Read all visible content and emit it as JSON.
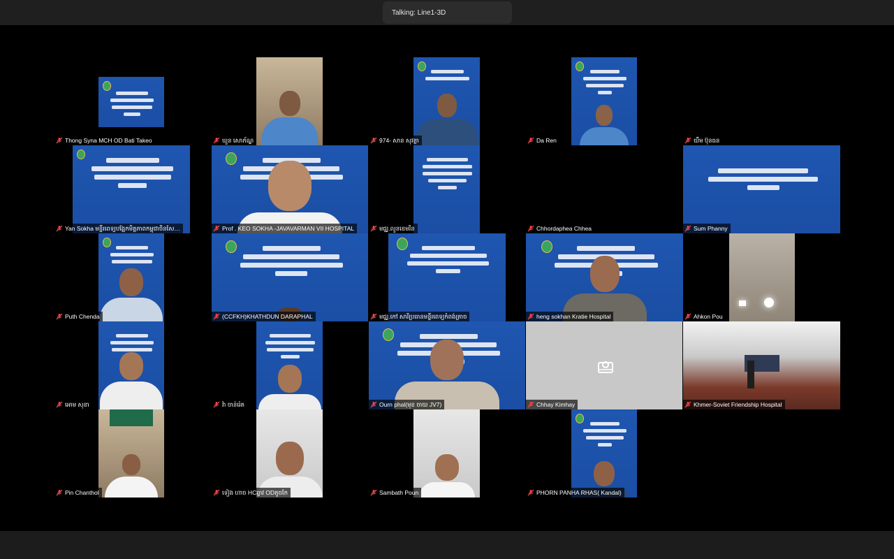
{
  "meeting": {
    "talking_label": "Talking: Line1-3D"
  },
  "participants": [
    {
      "name": "Thong Syna MCH OD Bati Takeo",
      "video": "slide"
    },
    {
      "name": "ឃួន សោភ័ណ្ឌ",
      "video": "room"
    },
    {
      "name": "974- សាន សុវត្ថា",
      "video": "slide"
    },
    {
      "name": "Da Ren",
      "video": "slide"
    },
    {
      "name": "យឹម ប៊ុនធន",
      "video": "none"
    },
    {
      "name": "Yan Sokha មន្ទីរពេទ្យបង្អែកមិត្តភាពកម្ពុជាចិនសែ…",
      "video": "slide"
    },
    {
      "name": "Prof . KEO SOKHA -JAVAVARMAN VII HOSPITAL",
      "video": "slide"
    },
    {
      "name": "មជ្ឈ.លួនខេមរិន",
      "video": "slide"
    },
    {
      "name": "Chhordaphea Chhea",
      "video": "none"
    },
    {
      "name": "Sum Phanny",
      "video": "slide"
    },
    {
      "name": "Puth Chenda",
      "video": "slide"
    },
    {
      "name": "(CCFKH)KHATHDUN DARAPHAL",
      "video": "slide"
    },
    {
      "name": "មជ្ឈ.កៅ សារីប្រធានមន្ទីរពេទ្យកំពង់ត្រាច",
      "video": "slide"
    },
    {
      "name": "heng sokhan Kratie Hospital",
      "video": "slide"
    },
    {
      "name": "Ahkon Pou",
      "video": "dark"
    },
    {
      "name": "អោម សុខា",
      "video": "slide"
    },
    {
      "name": "វ៉ា ចាន់រ៉េត",
      "video": "slide"
    },
    {
      "name": "Ourn phal(មុខ ចាយ JV7)",
      "video": "slide"
    },
    {
      "name": "Chhay Kimhay",
      "video": "off"
    },
    {
      "name": "Khmer-Soviet Friendship Hospital",
      "video": "hall"
    },
    {
      "name": "Pin Chanthol",
      "video": "room"
    },
    {
      "name": "ទៀង ហាច HCឆ្វាវ ODតូចកែ",
      "video": "white"
    },
    {
      "name": "Sambath Poun",
      "video": "white"
    },
    {
      "name": "PHORN PANHA RHAS( Kandal)",
      "video": "slide"
    }
  ],
  "colors": {
    "slide_blue": "#1f56b0",
    "label_bg": "#000000",
    "muted_mic": "#e64646"
  },
  "icons": {
    "muted": "mic-off-icon",
    "camera_off": "camera-off-icon"
  }
}
